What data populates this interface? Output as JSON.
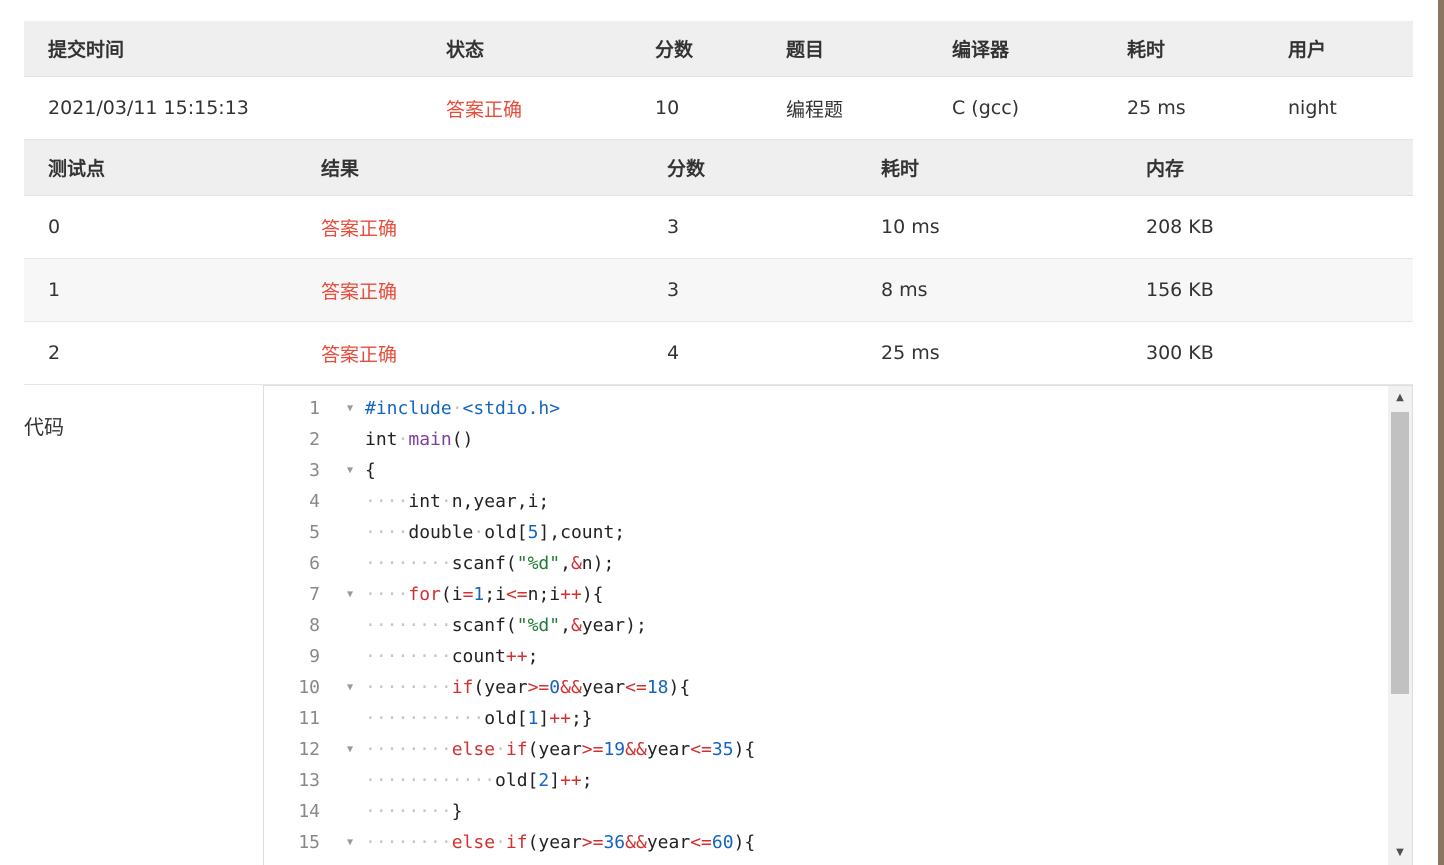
{
  "submission": {
    "headers": [
      "提交时间",
      "状态",
      "分数",
      "题目",
      "编译器",
      "耗时",
      "用户"
    ],
    "row": {
      "time": "2021/03/11 15:15:13",
      "status": "答案正确",
      "score": "10",
      "problem": "编程题",
      "compiler": "C (gcc)",
      "duration": "25 ms",
      "user": "night"
    }
  },
  "testcases": {
    "headers": [
      "测试点",
      "结果",
      "分数",
      "耗时",
      "内存"
    ],
    "rows": [
      {
        "id": "0",
        "result": "答案正确",
        "score": "3",
        "time": "10 ms",
        "memory": "208 KB"
      },
      {
        "id": "1",
        "result": "答案正确",
        "score": "3",
        "time": "8 ms",
        "memory": "156 KB"
      },
      {
        "id": "2",
        "result": "答案正确",
        "score": "4",
        "time": "25 ms",
        "memory": "300 KB"
      }
    ]
  },
  "code": {
    "label": "代码",
    "lines": [
      {
        "n": "1",
        "fold": true,
        "indent": 0,
        "tokens": [
          [
            "pp",
            "#include"
          ],
          [
            "ws",
            " "
          ],
          [
            "str2",
            "<stdio.h>"
          ]
        ]
      },
      {
        "n": "2",
        "fold": false,
        "indent": 0,
        "tokens": [
          [
            "t",
            "int"
          ],
          [
            "ws",
            " "
          ],
          [
            "fn",
            "main"
          ],
          [
            "t",
            "()"
          ]
        ]
      },
      {
        "n": "3",
        "fold": true,
        "indent": 0,
        "tokens": [
          [
            "t",
            "{"
          ]
        ]
      },
      {
        "n": "4",
        "fold": false,
        "indent": 4,
        "tokens": [
          [
            "t",
            "int"
          ],
          [
            "ws",
            " "
          ],
          [
            "t",
            "n,year,i;"
          ]
        ]
      },
      {
        "n": "5",
        "fold": false,
        "indent": 4,
        "tokens": [
          [
            "t",
            "double"
          ],
          [
            "ws",
            " "
          ],
          [
            "t",
            "old["
          ],
          [
            "num",
            "5"
          ],
          [
            "t",
            "],count;"
          ]
        ]
      },
      {
        "n": "6",
        "fold": false,
        "indent": 8,
        "tokens": [
          [
            "t",
            "scanf("
          ],
          [
            "str",
            "\"%d\""
          ],
          [
            "t",
            ","
          ],
          [
            "op",
            "&"
          ],
          [
            "t",
            "n);"
          ]
        ]
      },
      {
        "n": "7",
        "fold": true,
        "indent": 4,
        "tokens": [
          [
            "kw",
            "for"
          ],
          [
            "t",
            "(i"
          ],
          [
            "op",
            "="
          ],
          [
            "num",
            "1"
          ],
          [
            "t",
            ";i"
          ],
          [
            "op",
            "<="
          ],
          [
            "t",
            "n;i"
          ],
          [
            "op",
            "++"
          ],
          [
            "t",
            "){"
          ]
        ]
      },
      {
        "n": "8",
        "fold": false,
        "indent": 8,
        "tokens": [
          [
            "t",
            "scanf("
          ],
          [
            "str",
            "\"%d\""
          ],
          [
            "t",
            ","
          ],
          [
            "op",
            "&"
          ],
          [
            "t",
            "year);"
          ]
        ]
      },
      {
        "n": "9",
        "fold": false,
        "indent": 8,
        "tokens": [
          [
            "t",
            "count"
          ],
          [
            "op",
            "++"
          ],
          [
            "t",
            ";"
          ]
        ]
      },
      {
        "n": "10",
        "fold": true,
        "indent": 8,
        "tokens": [
          [
            "kw",
            "if"
          ],
          [
            "t",
            "(year"
          ],
          [
            "op",
            ">="
          ],
          [
            "num",
            "0"
          ],
          [
            "op",
            "&&"
          ],
          [
            "t",
            "year"
          ],
          [
            "op",
            "<="
          ],
          [
            "num",
            "18"
          ],
          [
            "t",
            "){"
          ]
        ]
      },
      {
        "n": "11",
        "fold": false,
        "indent": 11,
        "tokens": [
          [
            "t",
            "old["
          ],
          [
            "num",
            "1"
          ],
          [
            "t",
            "]"
          ],
          [
            "op",
            "++"
          ],
          [
            "t",
            ";}"
          ]
        ]
      },
      {
        "n": "12",
        "fold": true,
        "indent": 8,
        "tokens": [
          [
            "kw",
            "else"
          ],
          [
            "ws",
            " "
          ],
          [
            "kw",
            "if"
          ],
          [
            "t",
            "(year"
          ],
          [
            "op",
            ">="
          ],
          [
            "num",
            "19"
          ],
          [
            "op",
            "&&"
          ],
          [
            "t",
            "year"
          ],
          [
            "op",
            "<="
          ],
          [
            "num",
            "35"
          ],
          [
            "t",
            "){"
          ]
        ]
      },
      {
        "n": "13",
        "fold": false,
        "indent": 12,
        "tokens": [
          [
            "t",
            "old["
          ],
          [
            "num",
            "2"
          ],
          [
            "t",
            "]"
          ],
          [
            "op",
            "++"
          ],
          [
            "t",
            ";"
          ]
        ]
      },
      {
        "n": "14",
        "fold": false,
        "indent": 8,
        "tokens": [
          [
            "t",
            "}"
          ]
        ]
      },
      {
        "n": "15",
        "fold": true,
        "indent": 8,
        "tokens": [
          [
            "kw",
            "else"
          ],
          [
            "ws",
            " "
          ],
          [
            "kw",
            "if"
          ],
          [
            "t",
            "(year"
          ],
          [
            "op",
            ">="
          ],
          [
            "num",
            "36"
          ],
          [
            "op",
            "&&"
          ],
          [
            "t",
            "year"
          ],
          [
            "op",
            "<="
          ],
          [
            "num",
            "60"
          ],
          [
            "t",
            "){"
          ]
        ]
      }
    ]
  },
  "colors": {
    "accent_ok": "#e74c3c",
    "keyword": "#d32f2f",
    "number": "#1565c0",
    "preproc": "#1565c0",
    "function": "#7b3fa0",
    "string": "#1e7b34"
  }
}
